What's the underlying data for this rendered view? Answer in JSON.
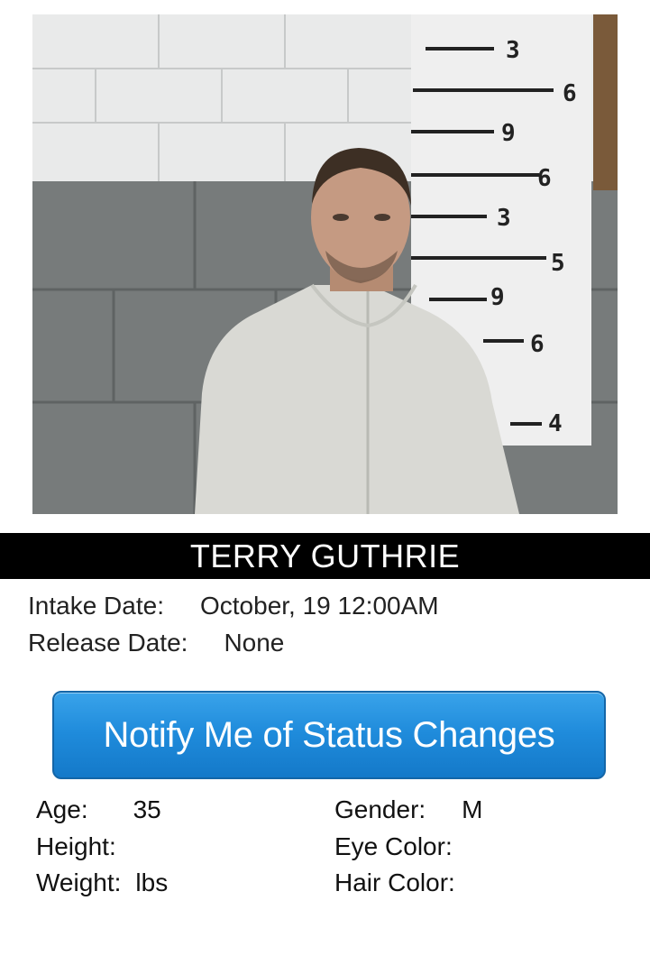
{
  "photo": {
    "ruler_marks": [
      "3",
      "6",
      "9",
      "6",
      "3",
      "5",
      "9",
      "6",
      "4"
    ]
  },
  "inmate": {
    "name": "TERRY GUTHRIE"
  },
  "intake": {
    "label": "Intake Date:",
    "value": "October, 19 12:00AM"
  },
  "release": {
    "label": "Release Date:",
    "value": "None"
  },
  "notify_button": {
    "label": "Notify Me of Status Changes"
  },
  "attributes": {
    "age": {
      "label": "Age:",
      "value": "35"
    },
    "height": {
      "label": "Height:",
      "value": ""
    },
    "weight": {
      "label": "Weight:",
      "value": "lbs"
    },
    "gender": {
      "label": "Gender:",
      "value": "M"
    },
    "eye_color": {
      "label": "Eye Color:",
      "value": ""
    },
    "hair_color": {
      "label": "Hair Color:",
      "value": ""
    }
  },
  "colors": {
    "button_blue": "#1f8bdb",
    "name_bar": "#000000"
  }
}
